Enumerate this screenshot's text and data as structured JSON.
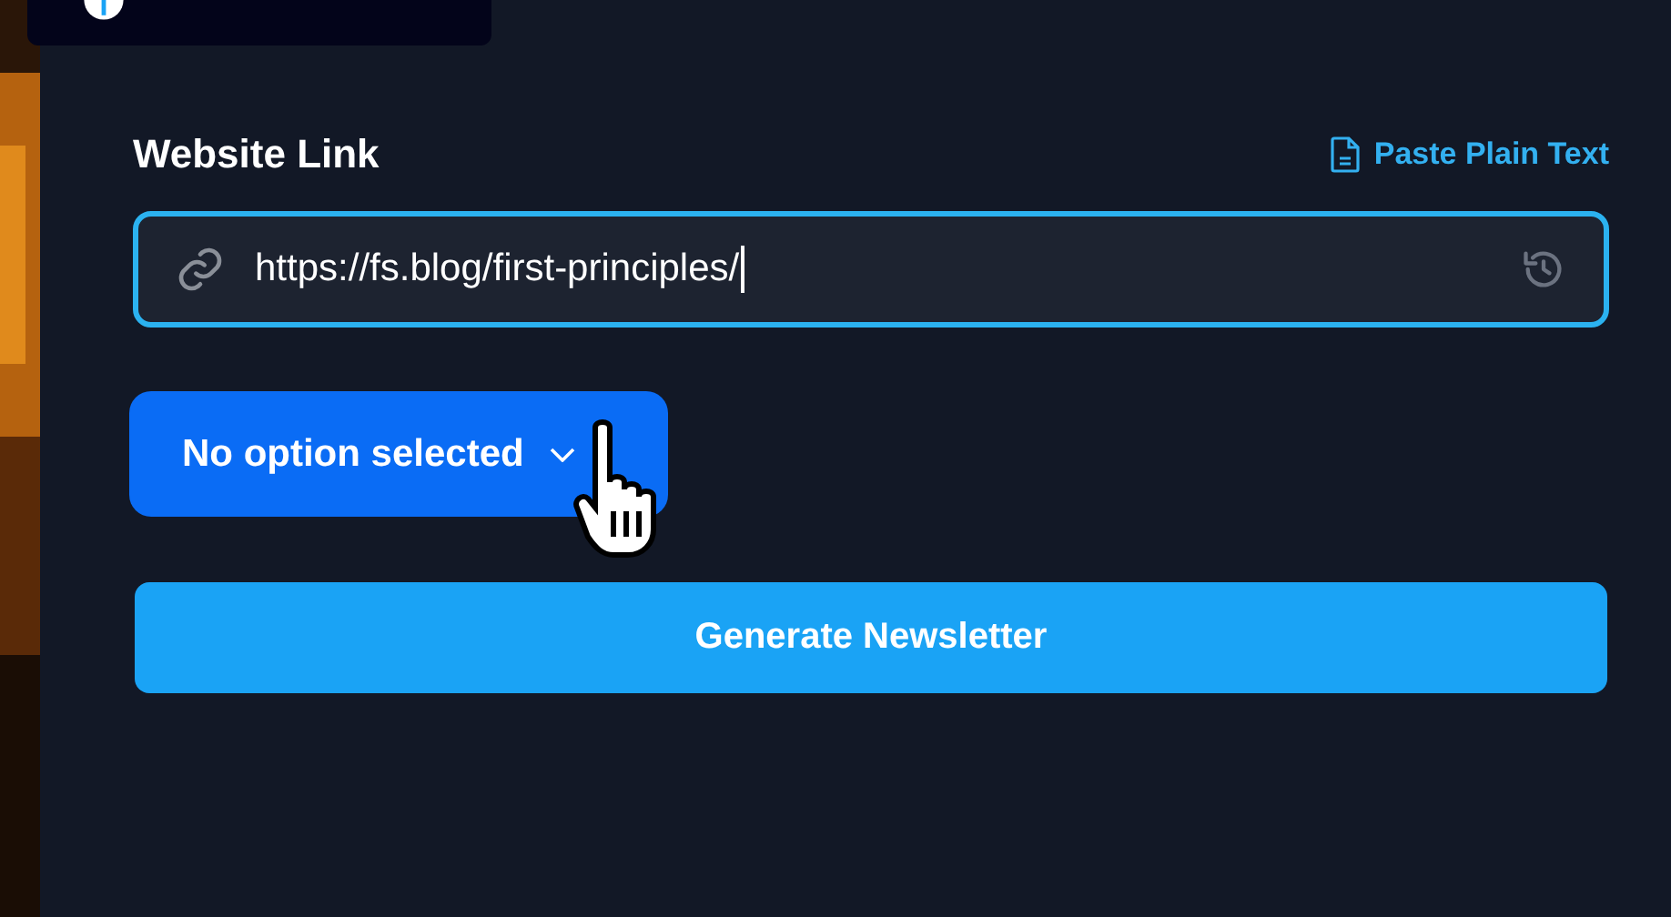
{
  "form": {
    "label": "Website Link",
    "paste_link": "Paste Plain Text",
    "url_field": {
      "value": "https://fs.blog/first-principles/"
    },
    "option_dropdown": {
      "label": "No option selected"
    },
    "submit_button": "Generate Newsletter"
  }
}
